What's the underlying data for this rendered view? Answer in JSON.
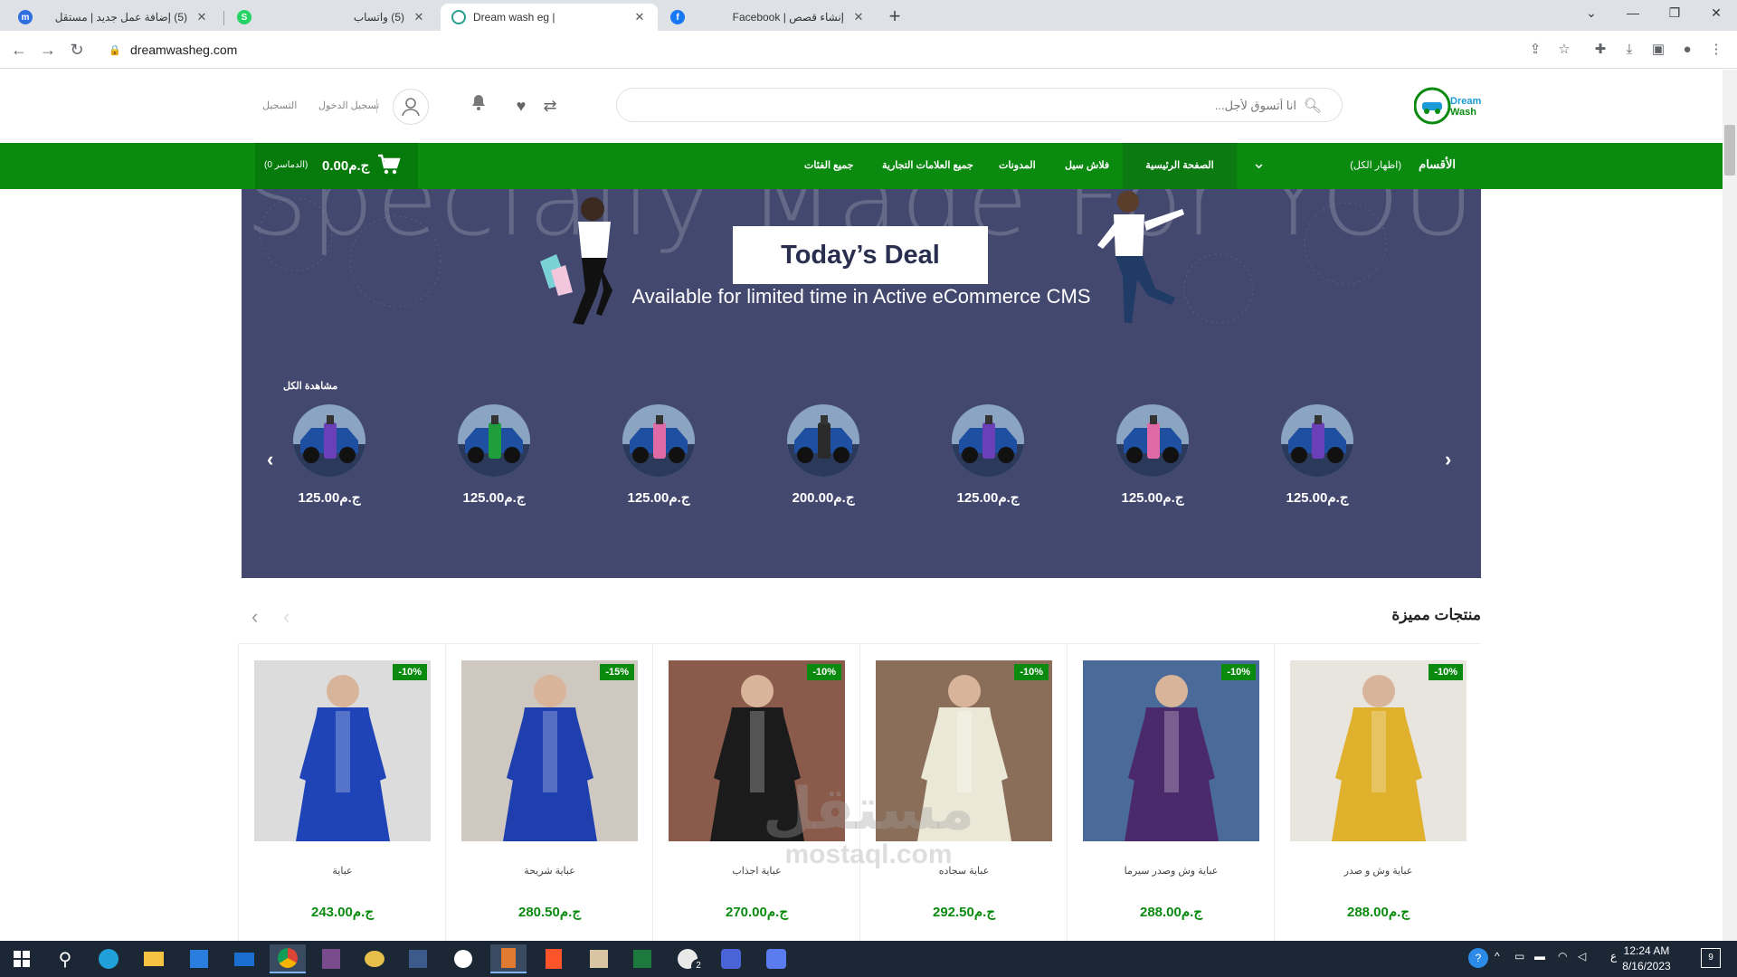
{
  "browser": {
    "tabs": [
      {
        "title": "(5) إضافة عمل جديد | مستقل",
        "favicon_color": "#2e6fe0"
      },
      {
        "title": "(5) واتساب",
        "favicon_color": "#25d366"
      },
      {
        "title": "Dream wash eg |",
        "favicon_color": "#2a9d8f"
      },
      {
        "title": "إنشاء قصص | Facebook",
        "favicon_color": "#1877f2"
      }
    ],
    "active_tab": 2,
    "url": "dreamwasheg.com",
    "new_tab": "+",
    "window_controls": [
      "⌄",
      "—",
      "❐",
      "✕"
    ]
  },
  "site": {
    "logo_text": [
      "Dream",
      "Wash"
    ],
    "search_placeholder": "انا أتسوق لأجل...",
    "auth": {
      "login": "تسجيل الدخول",
      "register": "التسجيل"
    },
    "categories_label": "الأقسام",
    "categories_show": "(اظهار الكل)",
    "nav": [
      "الصفحة الرئيسية",
      "فلاش سيل",
      "المدونات",
      "جميع العلامات التجارية",
      "جميع الفئات"
    ],
    "cart": {
      "total": "ج.م0.00",
      "count": "(0 الدماسر)"
    }
  },
  "banner": {
    "background_text": "Specially Made For YOU",
    "title": "Today’s Deal",
    "subtitle": "Available for limited time in Active eCommerce CMS",
    "view_all": "مشاهدة الكل",
    "prev": "‹",
    "next": "›"
  },
  "deals": [
    {
      "price": "ج.م125.00",
      "bottle": "#6a3fb8"
    },
    {
      "price": "ج.م125.00",
      "bottle": "#e06aa6"
    },
    {
      "price": "ج.م125.00",
      "bottle": "#6a3fb8"
    },
    {
      "price": "ج.م200.00",
      "bottle": "#2b2b2b"
    },
    {
      "price": "ج.م125.00",
      "bottle": "#e06aa6"
    },
    {
      "price": "ج.م125.00",
      "bottle": "#1f9e3e"
    },
    {
      "price": "ج.م125.00",
      "bottle": "#6a3fb8"
    }
  ],
  "featured": {
    "heading": "منتجات مميزة",
    "prev": "‹",
    "next": "‹",
    "products": [
      {
        "name": "عباية وش و صدر",
        "price": "ج.م288.00",
        "discount": "-10%",
        "color": "#e0b12c",
        "bg": "#e8e4de"
      },
      {
        "name": "عباية وش وصدر سيرما",
        "price": "ج.م288.00",
        "discount": "-10%",
        "color": "#4b2a6b",
        "bg": "#4a6a9a"
      },
      {
        "name": "عباية سجاده",
        "price": "ج.م292.50",
        "discount": "-10%",
        "color": "#ece8d8",
        "bg": "#8a6e5a"
      },
      {
        "name": "عباية اجذاب",
        "price": "ج.م270.00",
        "discount": "-10%",
        "color": "#1b1b1b",
        "bg": "#8a5a4a"
      },
      {
        "name": "عباية شريحة",
        "price": "ج.م280.50",
        "discount": "-15%",
        "color": "#1f3fae",
        "bg": "#cfc8c0"
      },
      {
        "name": "عباية",
        "price": "ج.م243.00",
        "discount": "-10%",
        "color": "#1e44b8",
        "bg": "#dcdcdc"
      }
    ]
  },
  "watermark": {
    "ar": "مستقل",
    "en": "mostaql.com"
  },
  "taskbar": {
    "time": "12:24 AM",
    "date": "8/16/2023",
    "lang": "ع",
    "notifications": "9",
    "whatsapp_badge": "2"
  },
  "colors": {
    "brand_green": "#0a8a0f",
    "banner_bg": "#43486e"
  }
}
